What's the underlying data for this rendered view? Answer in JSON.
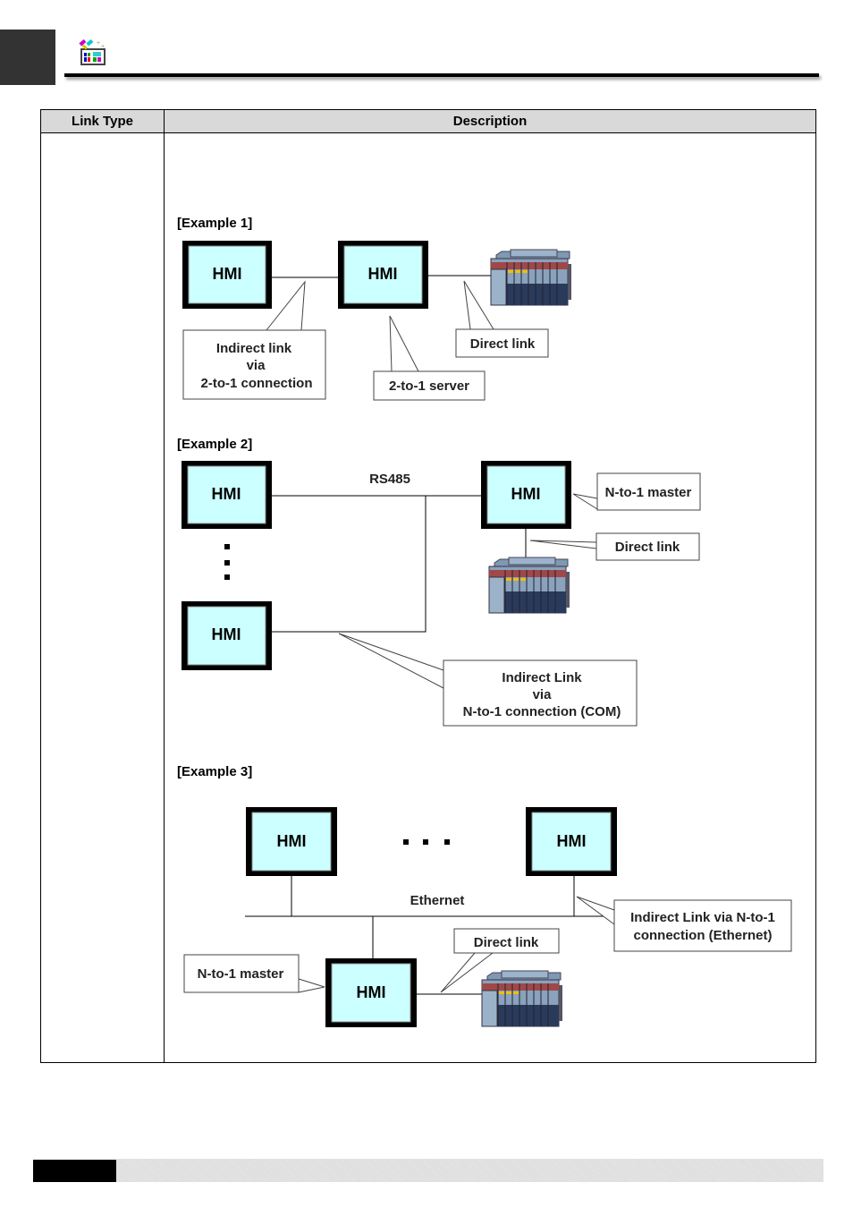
{
  "header": {
    "icon": "hmi-toolbox-icon"
  },
  "table": {
    "headers": [
      "Link Type",
      "Description"
    ],
    "row": {
      "link_type": ""
    }
  },
  "examples": [
    {
      "title": "[Example 1]",
      "hmi_label": "HMI",
      "callouts": {
        "indirect": [
          "Indirect link",
          "via",
          "2-to-1 connection"
        ],
        "server": "2-to-1 server",
        "direct": "Direct link"
      }
    },
    {
      "title": "[Example 2]",
      "hmi_label": "HMI",
      "bus_label": "RS485",
      "callouts": {
        "master": "N-to-1 master",
        "direct": "Direct link",
        "indirect": [
          "Indirect Link",
          "via",
          "N-to-1 connection (COM)"
        ]
      }
    },
    {
      "title": "[Example 3]",
      "hmi_label": "HMI",
      "bus_label": "Ethernet",
      "callouts": {
        "indirect": [
          "Indirect Link via N-to-1",
          "connection (Ethernet)"
        ],
        "direct": "Direct link",
        "master": "N-to-1 master"
      }
    }
  ],
  "colors": {
    "hmi_screen": "#ccffff",
    "header_bg": "#d9d9d9",
    "corner": "#333333"
  }
}
